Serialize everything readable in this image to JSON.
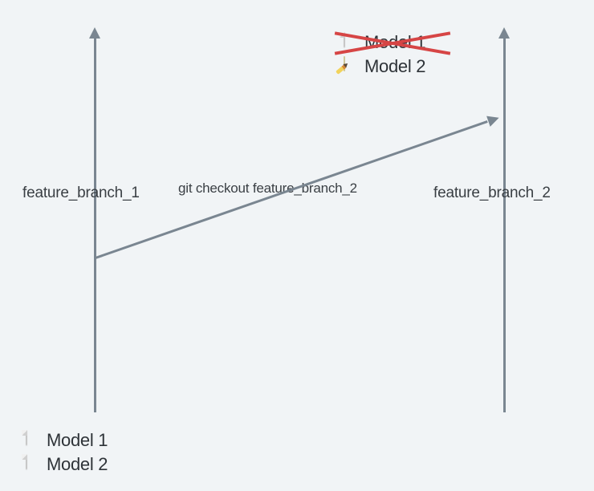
{
  "branches": {
    "left": {
      "label": "feature_branch_1"
    },
    "right": {
      "label": "feature_branch_2"
    }
  },
  "command": "git checkout feature_branch_2",
  "files_bottom_left": [
    {
      "name": "Model 1",
      "icon": "document-icon"
    },
    {
      "name": "Model 2",
      "icon": "document-icon"
    }
  ],
  "files_top_right": [
    {
      "name": "Model 1",
      "icon": "document-icon",
      "struck": true
    },
    {
      "name": "Model 2",
      "icon": "edit-document-icon",
      "struck": false
    }
  ],
  "colors": {
    "line": "#7a8691",
    "strike": "#d64545",
    "bg": "#f1f4f6",
    "text": "#3a3f44"
  }
}
